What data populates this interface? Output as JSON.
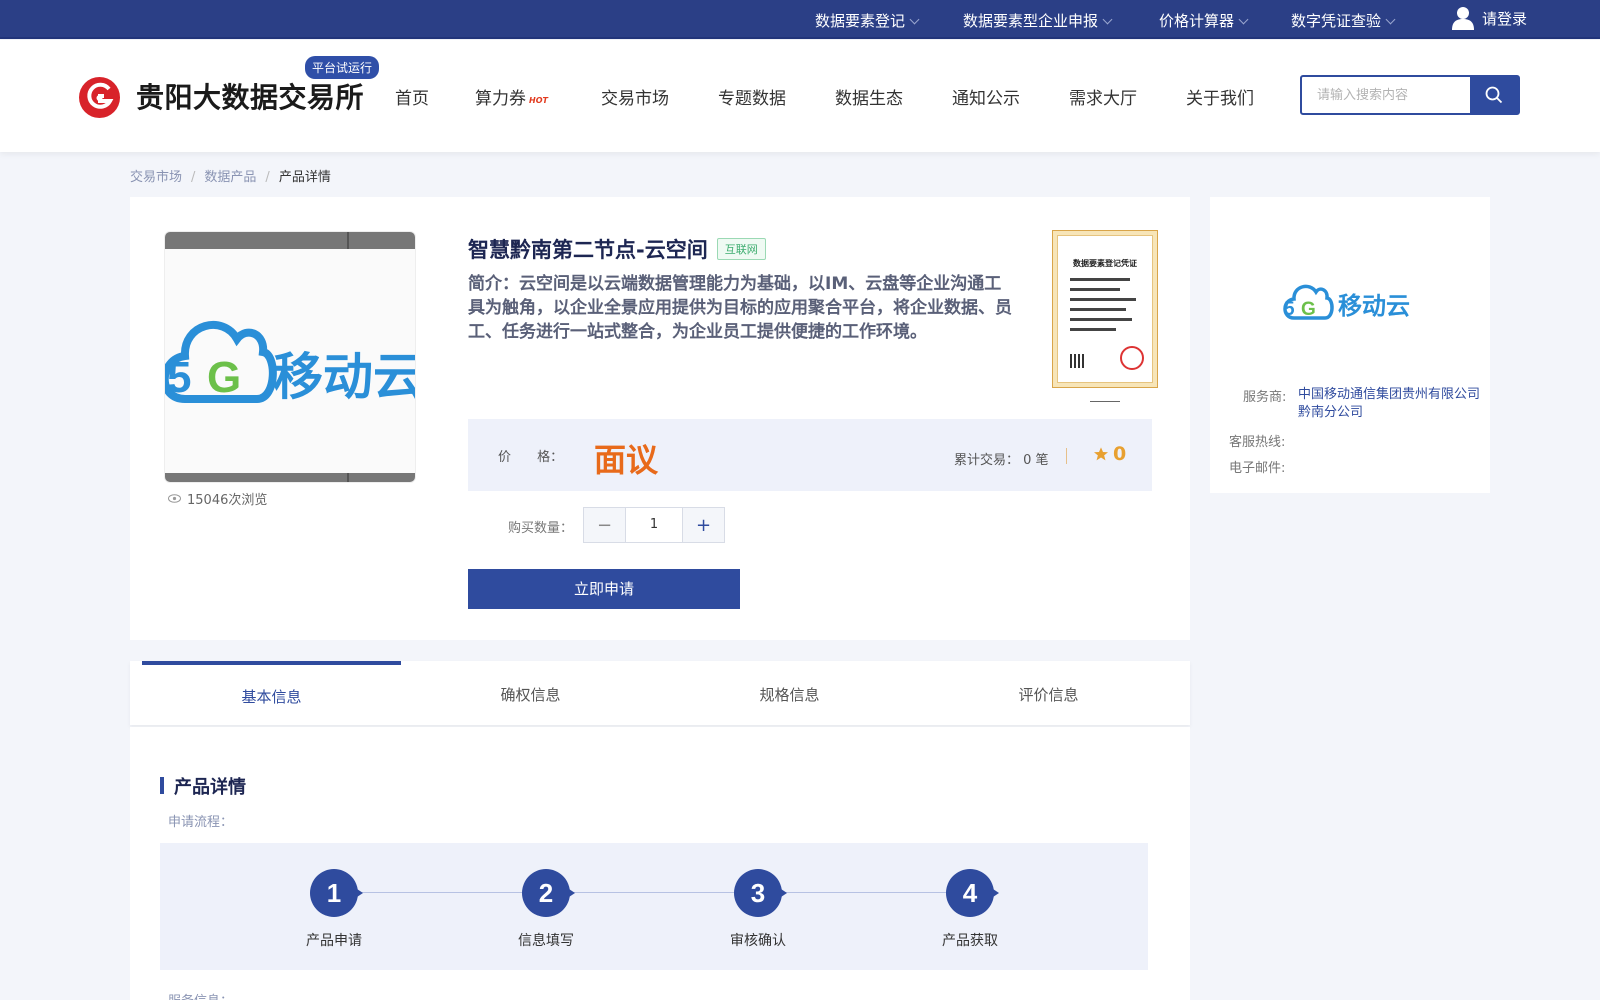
{
  "topbar": {
    "links": [
      "数据要素登记",
      "数据要素型企业申报",
      "价格计算器",
      "数字凭证查验"
    ],
    "login": "请登录"
  },
  "header": {
    "brand": "贵阳大数据交易所",
    "trial_badge": "平台试运行",
    "nav": [
      "首页",
      "算力券",
      "交易市场",
      "专题数据",
      "数据生态",
      "通知公示",
      "需求大厅",
      "关于我们"
    ],
    "hot_tag": "HOT",
    "search_placeholder": "请输入搜索内容"
  },
  "breadcrumb": [
    "交易市场",
    "数据产品",
    "产品详情"
  ],
  "product": {
    "title": "智慧黔南第二节点-云空间",
    "tag": "互联网",
    "description": "简介：云空间是以云端数据管理能力为基础，以IM、云盘等企业沟通工具为触角，以企业全景应用提供为目标的应用聚合平台，将企业数据、员工、任务进行一站式整合，为企业员工提供便捷的工作环境。",
    "views": "15046次浏览",
    "cert_title": "数据要素登记凭证",
    "price_label": "价 格：",
    "price": "面议",
    "trades": "累计交易： 0 笔",
    "rating": "0",
    "qty_label": "购买数量：",
    "qty": "1",
    "apply_button": "立即申请"
  },
  "vendor": {
    "provider_label": "服务商:",
    "provider": "中国移动通信集团贵州有限公司黔南分公司",
    "hotline_label": "客服热线:",
    "email_label": "电子邮件:"
  },
  "tabs": [
    "基本信息",
    "确权信息",
    "规格信息",
    "评价信息"
  ],
  "detail": {
    "title": "产品详情",
    "process_label": "申请流程：",
    "steps": [
      {
        "num": "1",
        "label": "产品申请"
      },
      {
        "num": "2",
        "label": "信息填写"
      },
      {
        "num": "3",
        "label": "审核确认"
      },
      {
        "num": "4",
        "label": "产品获取"
      }
    ],
    "service_label": "服务信息："
  },
  "colors": {
    "primary": "#2f4b9e",
    "topbar": "#2b3f86",
    "price": "#e86a1a",
    "logo_red": "#d8232a"
  }
}
